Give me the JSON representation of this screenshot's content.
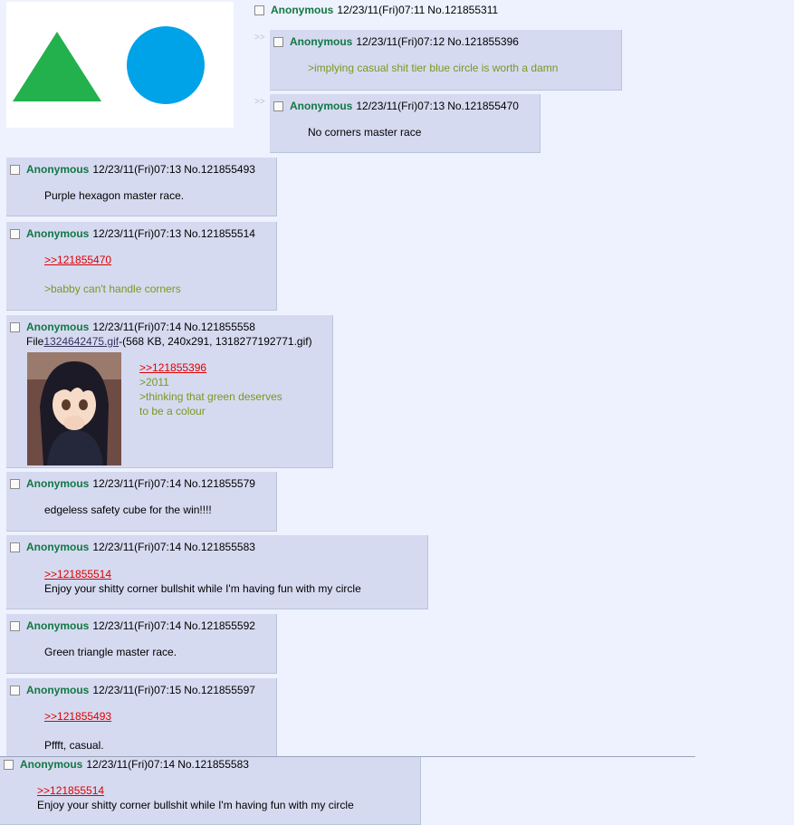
{
  "op": {
    "name": "Anonymous",
    "date": "12/23/11(Fri)07:11",
    "no": "No.121855311",
    "triangle_color": "#22b14c",
    "circle_color": "#00a2e8"
  },
  "arrow_glyph": ">>",
  "posts": [
    {
      "name": "Anonymous",
      "date": "12/23/11(Fri)07:12",
      "no": "No.121855396",
      "lines": [
        ">implying casual shit tier blue circle is worth a damn"
      ]
    },
    {
      "name": "Anonymous",
      "date": "12/23/11(Fri)07:13",
      "no": "No.121855470",
      "lines": [
        "No corners master race"
      ]
    },
    {
      "name": "Anonymous",
      "date": "12/23/11(Fri)07:13",
      "no": "No.121855493",
      "lines": [
        "Purple hexagon master race."
      ]
    },
    {
      "name": "Anonymous",
      "date": "12/23/11(Fri)07:13",
      "no": "No.121855514",
      "lines": [
        ">>121855470",
        ">babby can't handle corners"
      ]
    },
    {
      "name": "Anonymous",
      "date": "12/23/11(Fri)07:14",
      "no": "No.121855558",
      "file": {
        "prefix": "File",
        "name": "1324642475.gif",
        "details": "-(568 KB, 240x291, 1318277192771.gif)"
      },
      "lines": [
        ">>121855396",
        ">2011",
        ">thinking that green deserves",
        "to be a colour"
      ]
    },
    {
      "name": "Anonymous",
      "date": "12/23/11(Fri)07:14",
      "no": "No.121855579",
      "lines": [
        "edgeless safety cube for the win!!!!"
      ]
    },
    {
      "name": "Anonymous",
      "date": "12/23/11(Fri)07:14",
      "no": "No.121855583",
      "lines": [
        ">>121855514",
        "Enjoy your shitty corner bullshit while I'm having fun with my circle"
      ]
    },
    {
      "name": "Anonymous",
      "date": "12/23/11(Fri)07:14",
      "no": "No.121855592",
      "lines": [
        "Green triangle master race."
      ]
    },
    {
      "name": "Anonymous",
      "date": "12/23/11(Fri)07:15",
      "no": "No.121855597",
      "lines": [
        ">>121855493",
        "Pffft, casual."
      ]
    },
    {
      "name": "Anonymous",
      "date": "12/23/11(Fri)07:14",
      "no": "No.121855583",
      "lines": [
        ">>121855514",
        "Enjoy your shitty corner bullshit while I'm having fun with my circle"
      ]
    }
  ]
}
